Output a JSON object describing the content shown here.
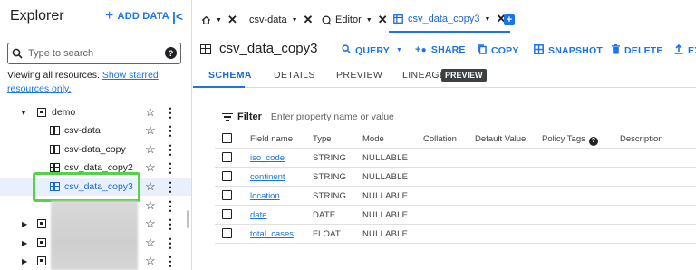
{
  "explorer": {
    "title": "Explorer",
    "add_data_label": "ADD DATA",
    "search": {
      "placeholder": "Type to search",
      "value": ""
    },
    "viewing_text": "Viewing all resources.",
    "show_starred_link": "Show starred resources only.",
    "tree": {
      "dataset": "demo",
      "tables": [
        "csv-data",
        "csv-data_copy",
        "csv_data_copy2",
        "csv_data_copy3"
      ],
      "selected": "csv_data_copy3"
    }
  },
  "tabs": [
    {
      "label": "csv-data"
    },
    {
      "label": "Editor"
    },
    {
      "label": "csv_data_copy3",
      "active": true
    }
  ],
  "toolbar": {
    "title": "csv_data_copy3",
    "query_label": "QUERY",
    "share_label": "SHARE",
    "copy_label": "COPY",
    "snapshot_label": "SNAPSHOT",
    "delete_label": "DELETE",
    "export_label": "EX"
  },
  "subtabs": {
    "schema": "SCHEMA",
    "details": "DETAILS",
    "preview": "PREVIEW",
    "lineage": "LINEAGE",
    "lineage_badge": "PREVIEW"
  },
  "filter": {
    "label": "Filter",
    "placeholder": "Enter property name or value"
  },
  "schema": {
    "headers": [
      "Field name",
      "Type",
      "Mode",
      "Collation",
      "Default Value",
      "Policy Tags",
      "Description"
    ],
    "rows": [
      {
        "name": "iso_code",
        "type": "STRING",
        "mode": "NULLABLE"
      },
      {
        "name": "continent",
        "type": "STRING",
        "mode": "NULLABLE"
      },
      {
        "name": "location",
        "type": "STRING",
        "mode": "NULLABLE"
      },
      {
        "name": "date",
        "type": "DATE",
        "mode": "NULLABLE"
      },
      {
        "name": "total_cases",
        "type": "FLOAT",
        "mode": "NULLABLE"
      }
    ]
  },
  "colors": {
    "accent": "#1a73e8",
    "highlight": "#57d04a",
    "selected_bg": "#e8f0fe"
  }
}
